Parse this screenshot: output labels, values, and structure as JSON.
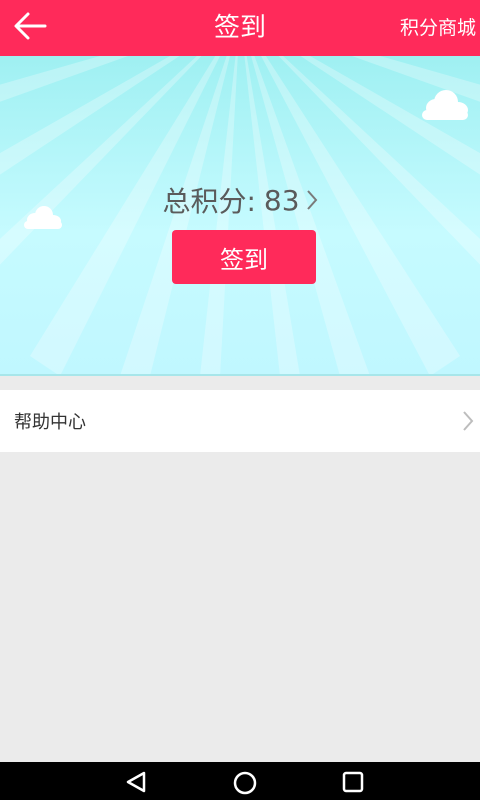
{
  "header": {
    "title": "签到",
    "right_link": "积分商城",
    "back_icon": "arrow-left-icon"
  },
  "hero": {
    "points_label": "总积分:",
    "points_value": "83",
    "checkin_button": "签到"
  },
  "list": {
    "items": [
      {
        "label": "帮助中心"
      }
    ]
  },
  "colors": {
    "brand": "#ff2a5a",
    "hero_background": "#c6fbff",
    "page_background": "#ebebeb"
  },
  "system_nav": {
    "icons": [
      "back-triangle-icon",
      "home-circle-icon",
      "recents-square-icon"
    ]
  }
}
